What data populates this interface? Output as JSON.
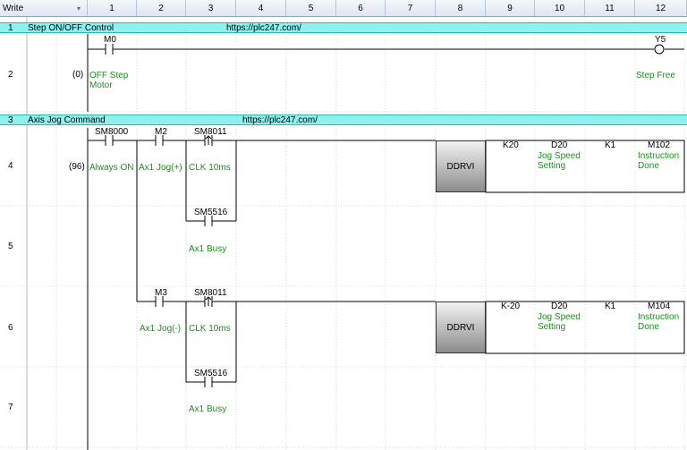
{
  "header": {
    "mode_label": "Write",
    "mode_arrow": "▾",
    "columns": [
      "1",
      "2",
      "3",
      "4",
      "5",
      "6",
      "7",
      "8",
      "9",
      "10",
      "11",
      "12"
    ]
  },
  "rows": {
    "r1": "1",
    "r2": "2",
    "r3": "3",
    "r4": "4",
    "r5": "5",
    "r6": "6",
    "r7": "7"
  },
  "comments": {
    "c1_title": "Step ON/OFF Control",
    "c1_url": "https://plc247.com/",
    "c2_title": "Axis Jog Command",
    "c2_url": "https://plc247.com/"
  },
  "rung1": {
    "step": "(0)",
    "m0": "M0",
    "m0_label1": "OFF Step",
    "m0_label2": "Motor",
    "y5": "Y5",
    "y5_label": "Step Free"
  },
  "rung2": {
    "step": "(96)",
    "sm8000": "SM8000",
    "sm8000_label": "Always ON",
    "m2": "M2",
    "m2_label": "Ax1 Jog(+)",
    "sm8011a": "SM8011",
    "sm8011a_label": "CLK 10ms",
    "sm5516a": "SM5516",
    "sm5516a_label": "Ax1 Busy",
    "ddrvi_a": "DDRVI",
    "k20": "K20",
    "d20a": "D20",
    "d20a_label1": "Jog Speed",
    "d20a_label2": "Setting",
    "k1a": "K1",
    "m102": "M102",
    "m102_label1": "Instruction",
    "m102_label2": "Done",
    "m3": "M3",
    "m3_label": "Ax1 Jog(-)",
    "sm8011b": "SM8011",
    "sm8011b_label": "CLK 10ms",
    "sm5516b": "SM5516",
    "sm5516b_label": "Ax1 Busy",
    "ddrvi_b": "DDRVI",
    "km20": "K-20",
    "d20b": "D20",
    "d20b_label1": "Jog Speed",
    "d20b_label2": "Setting",
    "k1b": "K1",
    "m104": "M104",
    "m104_label1": "Instruction",
    "m104_label2": "Done"
  },
  "colors": {
    "comment_bg": "#8ff0ee",
    "label_green": "#1b8e1b",
    "grid": "#c9c9c9",
    "header_bg": "#dfe6f1"
  }
}
